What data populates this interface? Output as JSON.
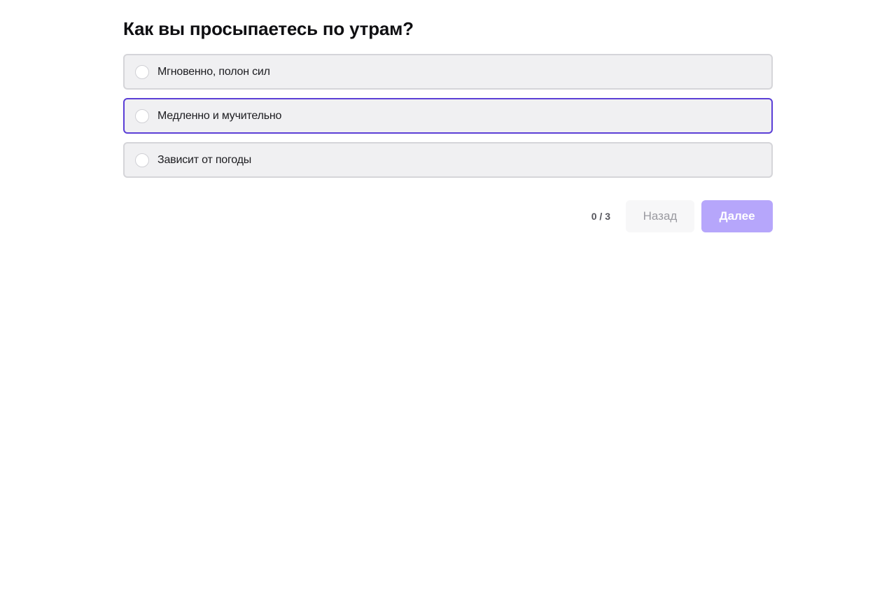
{
  "question": {
    "title": "Как вы просыпаетесь по утрам?"
  },
  "options": [
    {
      "label": "Мгновенно, полон сил",
      "selected": false
    },
    {
      "label": "Медленно и мучительно",
      "selected": false,
      "focused": true
    },
    {
      "label": "Зависит от погоды",
      "selected": false
    }
  ],
  "footer": {
    "progress": "0 / 3",
    "back_label": "Назад",
    "next_label": "Далее"
  },
  "colors": {
    "accent": "#5b3fd6",
    "next_button_disabled": "#b6a6fb",
    "option_background": "#f0f0f2",
    "option_border": "#d5d5d9"
  },
  "icons": {
    "option_marker": "radio-circle-icon"
  }
}
